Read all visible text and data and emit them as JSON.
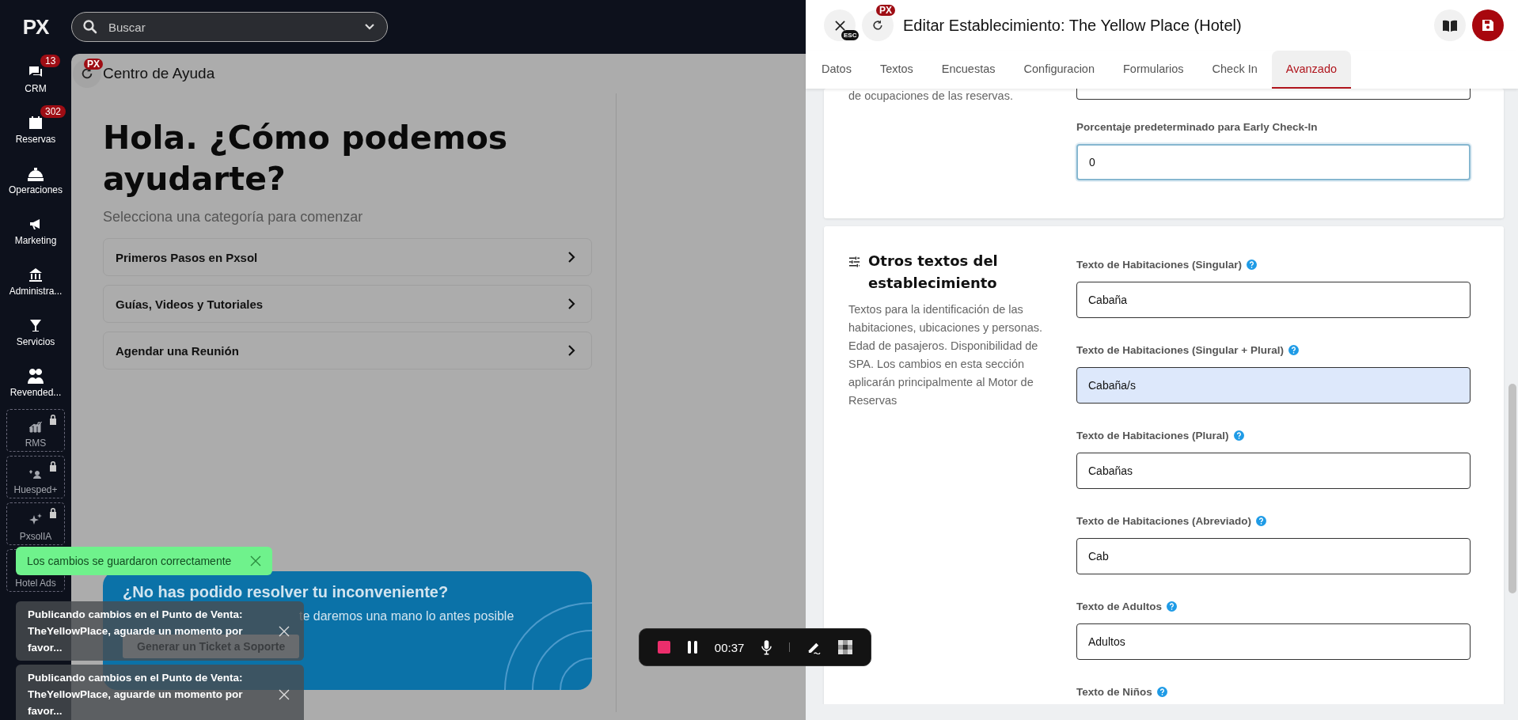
{
  "sidebar": {
    "logo": "PX",
    "items": [
      {
        "label": "CRM",
        "badge": "13",
        "locked": false
      },
      {
        "label": "Reservas",
        "badge": "302",
        "locked": false
      },
      {
        "label": "Operaciones",
        "locked": false
      },
      {
        "label": "Marketing",
        "locked": false
      },
      {
        "label": "Administra...",
        "locked": false
      },
      {
        "label": "Servicios",
        "locked": false
      },
      {
        "label": "Revended...",
        "locked": false
      },
      {
        "label": "RMS",
        "locked": true
      },
      {
        "label": "Huesped+",
        "locked": true
      },
      {
        "label": "PxsolIA",
        "locked": true
      },
      {
        "label": "Hotel Ads",
        "locked": true
      }
    ]
  },
  "search": {
    "placeholder": "Buscar"
  },
  "help_center": {
    "title": "Centro de Ayuda",
    "badge": "PX",
    "heading": "Hola. ¿Cómo podemos ayudarte?",
    "subtitle": "Selecciona una categoría para comenzar",
    "categories": [
      "Primeros Pasos en Pxsol",
      "Guías, Videos y Tutoriales",
      "Agendar una Reunión"
    ],
    "support_card": {
      "title": "¿No has podido resolver tu inconveniente?",
      "text": "te daremos una mano lo antes posible",
      "button": "Generar un Ticket a Soporte"
    }
  },
  "toasts": [
    {
      "kind": "success",
      "text": "Los cambios se guardaron correctamente"
    },
    {
      "kind": "info",
      "text": "Publicando cambios en el Punto de Venta: TheYellowPlace, aguarde un momento por favor..."
    },
    {
      "kind": "info",
      "text": "Publicando cambios en el Punto de Venta: TheYellowPlace, aguarde un momento por favor..."
    }
  ],
  "recorder": {
    "time": "00:37"
  },
  "panel": {
    "close_hint": "ESC",
    "badge": "PX",
    "title": "Editar Establecimiento: The Yellow Place (Hotel)",
    "tabs": [
      {
        "label": "Datos",
        "selected": false
      },
      {
        "label": "Textos",
        "selected": false
      },
      {
        "label": "Encuestas",
        "selected": false
      },
      {
        "label": "Configuracion",
        "selected": false
      },
      {
        "label": "Formularios",
        "selected": false
      },
      {
        "label": "Check In",
        "selected": false
      },
      {
        "label": "Avanzado",
        "selected": true
      }
    ],
    "cards": [
      {
        "description": "de ocupaciones de las reservas.",
        "fields": [
          {
            "label": "Porcentaje predeterminado para Early Check-In",
            "value": "0",
            "help": false,
            "focused": true,
            "autofilled": false
          }
        ]
      },
      {
        "title": "Otros textos del establecimiento",
        "description": "Textos para la identificación de las habitaciones, ubicaciones y personas. Edad de pasajeros. Disponibilidad de SPA. Los cambios en esta sección aplicarán principalmente al Motor de Reservas",
        "fields": [
          {
            "label": "Texto de Habitaciones (Singular)",
            "value": "Cabaña",
            "help": true,
            "focused": false,
            "autofilled": false
          },
          {
            "label": "Texto de Habitaciones (Singular + Plural)",
            "value": "Cabaña/s",
            "help": true,
            "focused": false,
            "autofilled": true
          },
          {
            "label": "Texto de Habitaciones (Plural)",
            "value": "Cabañas",
            "help": true,
            "focused": false,
            "autofilled": false
          },
          {
            "label": "Texto de Habitaciones (Abreviado)",
            "value": "Cab",
            "help": true,
            "focused": false,
            "autofilled": false
          },
          {
            "label": "Texto de Adultos",
            "value": "Adultos",
            "help": true,
            "focused": false,
            "autofilled": false
          },
          {
            "label": "Texto de Niños",
            "help": true
          }
        ]
      }
    ]
  }
}
